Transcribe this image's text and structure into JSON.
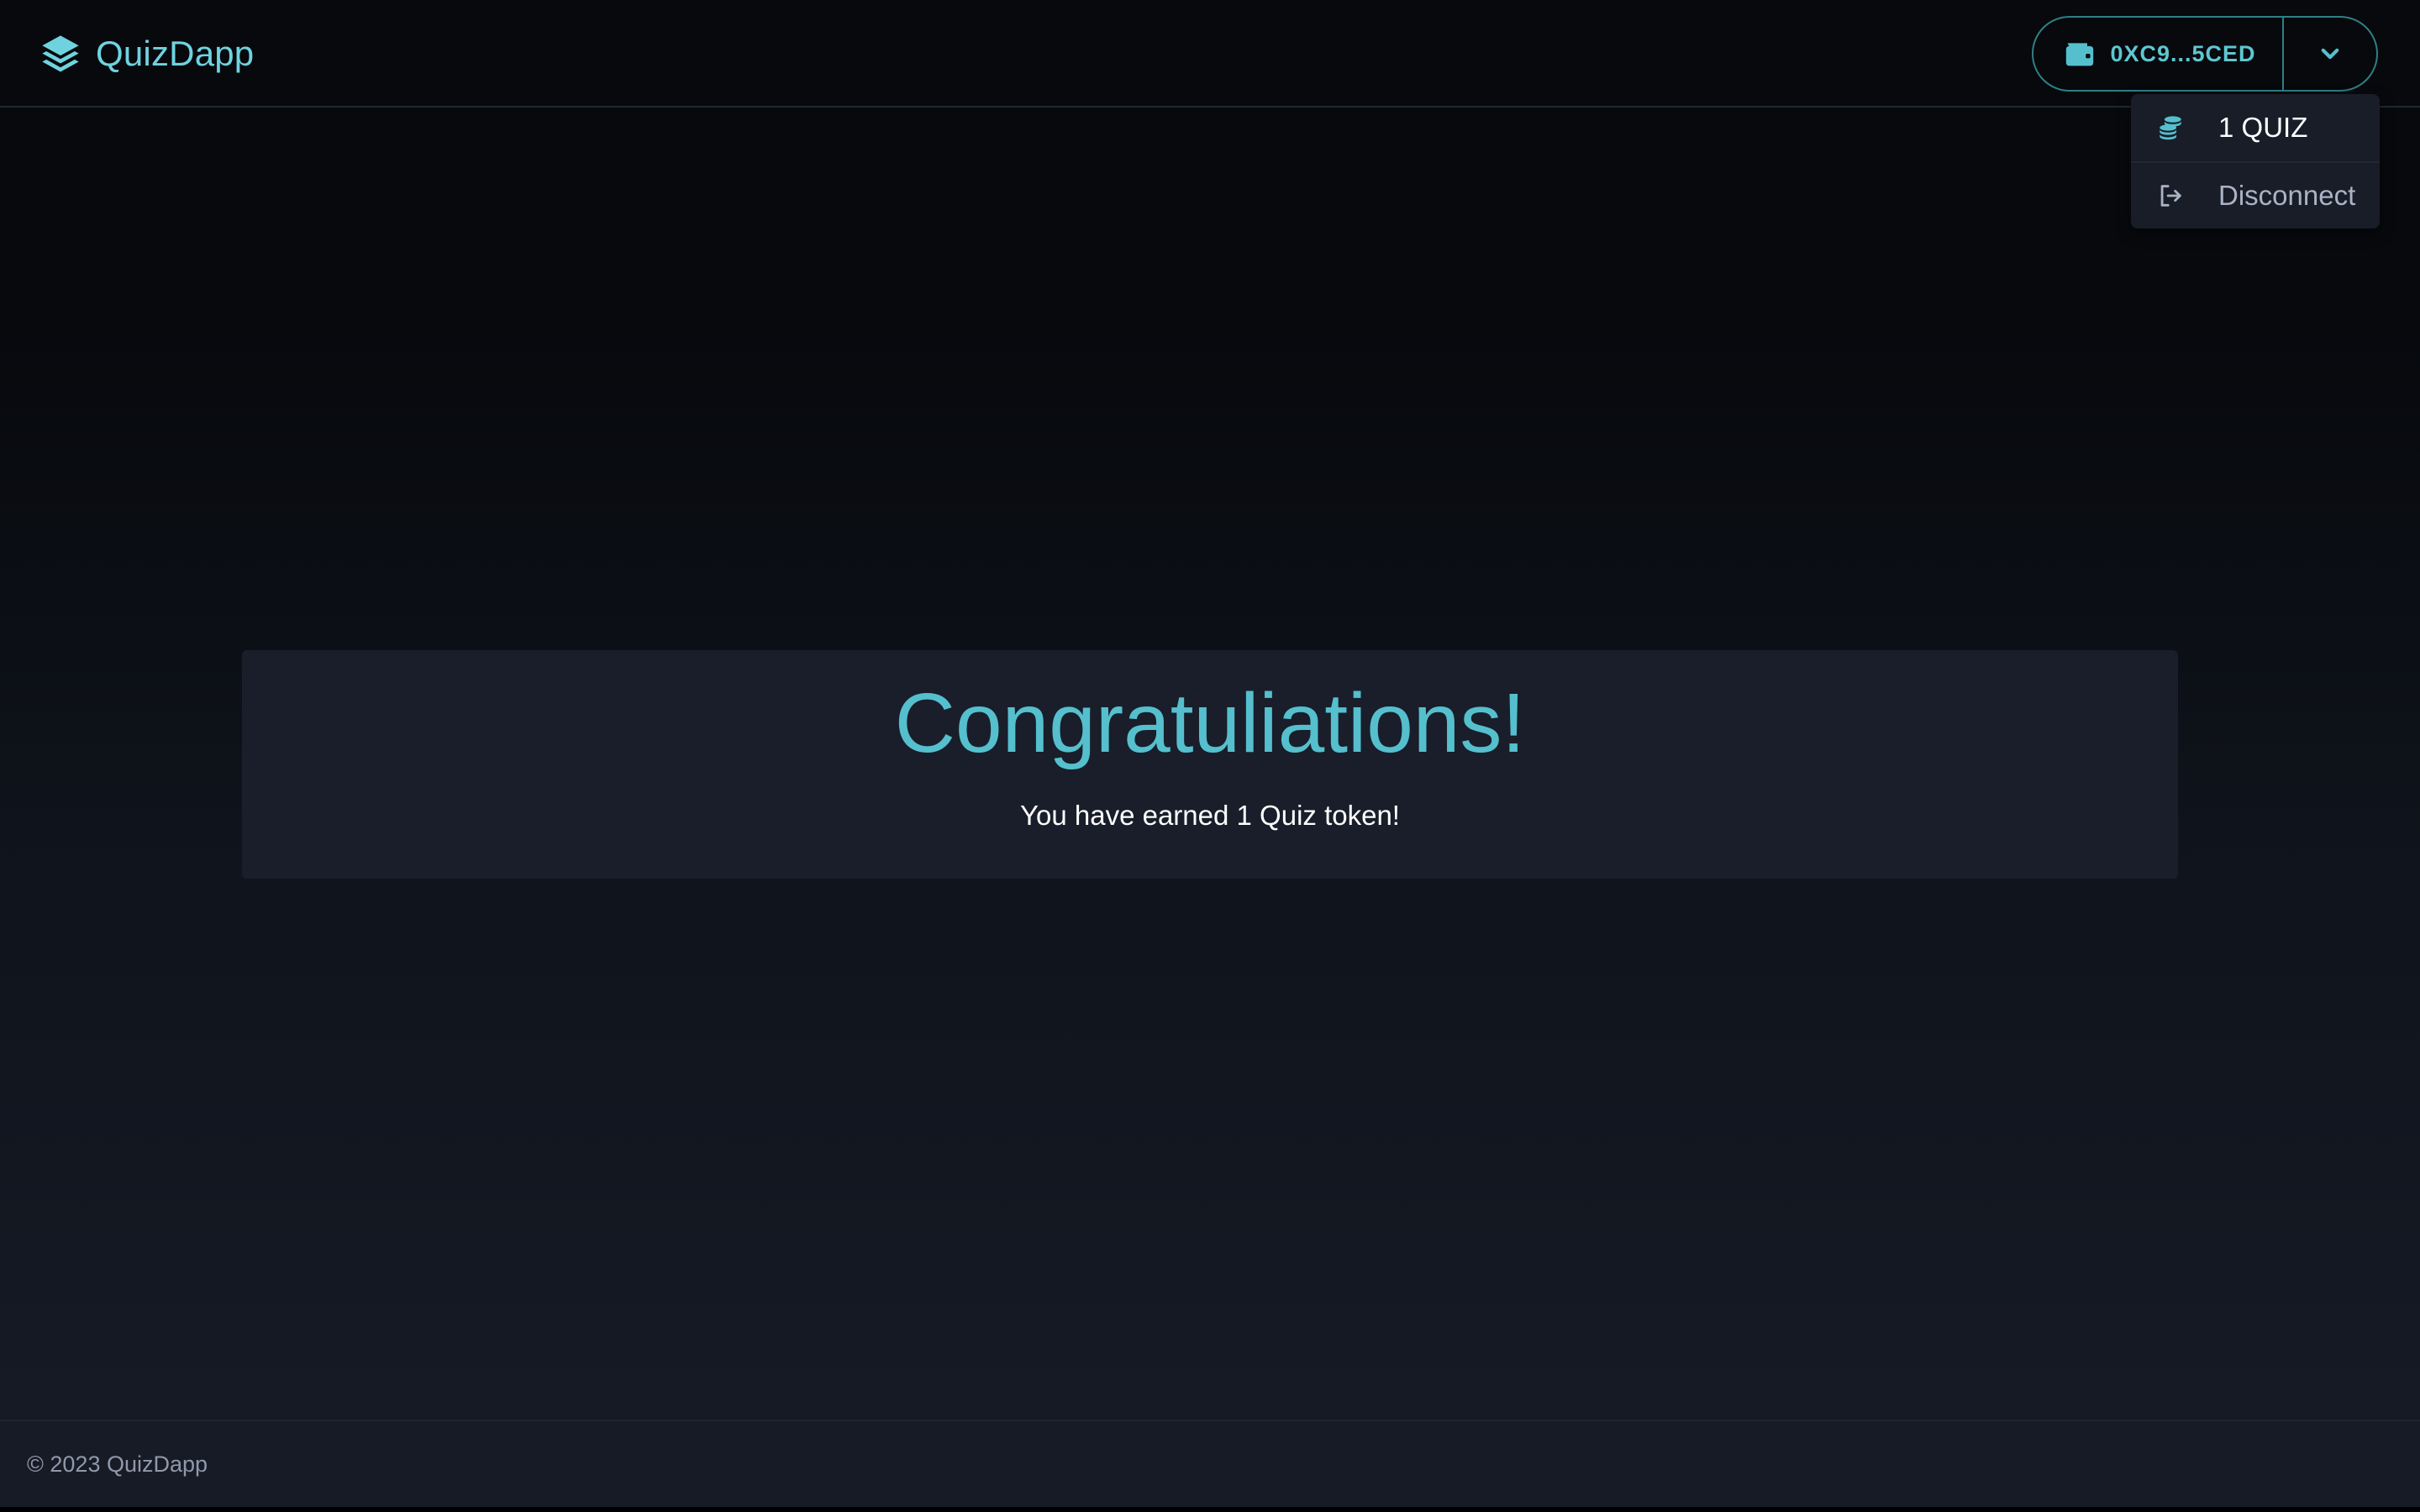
{
  "app": {
    "name": "QuizDapp",
    "logo_icon": "stacked-layers-icon"
  },
  "header": {
    "wallet": {
      "icon": "wallet-icon",
      "address": "0XC9...5CED",
      "toggle_icon": "chevron-down-icon"
    }
  },
  "dropdown": {
    "items": [
      {
        "icon": "coins-icon",
        "label": "1 QUIZ"
      },
      {
        "icon": "sign-out-icon",
        "label": "Disconnect"
      }
    ]
  },
  "main": {
    "title": "Congratuliations!",
    "message": "You have earned 1 Quiz token!"
  },
  "footer": {
    "text": "© 2023 QuizDapp"
  },
  "colors": {
    "accent": "#55bfcd",
    "brand": "#6fd3df",
    "background": "#07090d",
    "card": "#191e2a",
    "muted_text": "#a9b3c4"
  }
}
